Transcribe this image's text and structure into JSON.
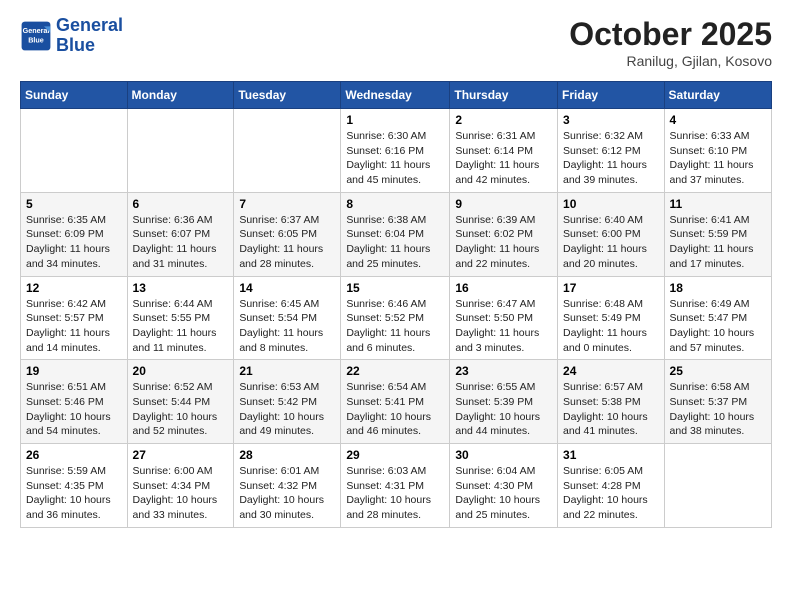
{
  "header": {
    "logo_line1": "General",
    "logo_line2": "Blue",
    "month_title": "October 2025",
    "location": "Ranilug, Gjilan, Kosovo"
  },
  "weekdays": [
    "Sunday",
    "Monday",
    "Tuesday",
    "Wednesday",
    "Thursday",
    "Friday",
    "Saturday"
  ],
  "weeks": [
    [
      {
        "day": "",
        "info": ""
      },
      {
        "day": "",
        "info": ""
      },
      {
        "day": "",
        "info": ""
      },
      {
        "day": "1",
        "info": "Sunrise: 6:30 AM\nSunset: 6:16 PM\nDaylight: 11 hours\nand 45 minutes."
      },
      {
        "day": "2",
        "info": "Sunrise: 6:31 AM\nSunset: 6:14 PM\nDaylight: 11 hours\nand 42 minutes."
      },
      {
        "day": "3",
        "info": "Sunrise: 6:32 AM\nSunset: 6:12 PM\nDaylight: 11 hours\nand 39 minutes."
      },
      {
        "day": "4",
        "info": "Sunrise: 6:33 AM\nSunset: 6:10 PM\nDaylight: 11 hours\nand 37 minutes."
      }
    ],
    [
      {
        "day": "5",
        "info": "Sunrise: 6:35 AM\nSunset: 6:09 PM\nDaylight: 11 hours\nand 34 minutes."
      },
      {
        "day": "6",
        "info": "Sunrise: 6:36 AM\nSunset: 6:07 PM\nDaylight: 11 hours\nand 31 minutes."
      },
      {
        "day": "7",
        "info": "Sunrise: 6:37 AM\nSunset: 6:05 PM\nDaylight: 11 hours\nand 28 minutes."
      },
      {
        "day": "8",
        "info": "Sunrise: 6:38 AM\nSunset: 6:04 PM\nDaylight: 11 hours\nand 25 minutes."
      },
      {
        "day": "9",
        "info": "Sunrise: 6:39 AM\nSunset: 6:02 PM\nDaylight: 11 hours\nand 22 minutes."
      },
      {
        "day": "10",
        "info": "Sunrise: 6:40 AM\nSunset: 6:00 PM\nDaylight: 11 hours\nand 20 minutes."
      },
      {
        "day": "11",
        "info": "Sunrise: 6:41 AM\nSunset: 5:59 PM\nDaylight: 11 hours\nand 17 minutes."
      }
    ],
    [
      {
        "day": "12",
        "info": "Sunrise: 6:42 AM\nSunset: 5:57 PM\nDaylight: 11 hours\nand 14 minutes."
      },
      {
        "day": "13",
        "info": "Sunrise: 6:44 AM\nSunset: 5:55 PM\nDaylight: 11 hours\nand 11 minutes."
      },
      {
        "day": "14",
        "info": "Sunrise: 6:45 AM\nSunset: 5:54 PM\nDaylight: 11 hours\nand 8 minutes."
      },
      {
        "day": "15",
        "info": "Sunrise: 6:46 AM\nSunset: 5:52 PM\nDaylight: 11 hours\nand 6 minutes."
      },
      {
        "day": "16",
        "info": "Sunrise: 6:47 AM\nSunset: 5:50 PM\nDaylight: 11 hours\nand 3 minutes."
      },
      {
        "day": "17",
        "info": "Sunrise: 6:48 AM\nSunset: 5:49 PM\nDaylight: 11 hours\nand 0 minutes."
      },
      {
        "day": "18",
        "info": "Sunrise: 6:49 AM\nSunset: 5:47 PM\nDaylight: 10 hours\nand 57 minutes."
      }
    ],
    [
      {
        "day": "19",
        "info": "Sunrise: 6:51 AM\nSunset: 5:46 PM\nDaylight: 10 hours\nand 54 minutes."
      },
      {
        "day": "20",
        "info": "Sunrise: 6:52 AM\nSunset: 5:44 PM\nDaylight: 10 hours\nand 52 minutes."
      },
      {
        "day": "21",
        "info": "Sunrise: 6:53 AM\nSunset: 5:42 PM\nDaylight: 10 hours\nand 49 minutes."
      },
      {
        "day": "22",
        "info": "Sunrise: 6:54 AM\nSunset: 5:41 PM\nDaylight: 10 hours\nand 46 minutes."
      },
      {
        "day": "23",
        "info": "Sunrise: 6:55 AM\nSunset: 5:39 PM\nDaylight: 10 hours\nand 44 minutes."
      },
      {
        "day": "24",
        "info": "Sunrise: 6:57 AM\nSunset: 5:38 PM\nDaylight: 10 hours\nand 41 minutes."
      },
      {
        "day": "25",
        "info": "Sunrise: 6:58 AM\nSunset: 5:37 PM\nDaylight: 10 hours\nand 38 minutes."
      }
    ],
    [
      {
        "day": "26",
        "info": "Sunrise: 5:59 AM\nSunset: 4:35 PM\nDaylight: 10 hours\nand 36 minutes."
      },
      {
        "day": "27",
        "info": "Sunrise: 6:00 AM\nSunset: 4:34 PM\nDaylight: 10 hours\nand 33 minutes."
      },
      {
        "day": "28",
        "info": "Sunrise: 6:01 AM\nSunset: 4:32 PM\nDaylight: 10 hours\nand 30 minutes."
      },
      {
        "day": "29",
        "info": "Sunrise: 6:03 AM\nSunset: 4:31 PM\nDaylight: 10 hours\nand 28 minutes."
      },
      {
        "day": "30",
        "info": "Sunrise: 6:04 AM\nSunset: 4:30 PM\nDaylight: 10 hours\nand 25 minutes."
      },
      {
        "day": "31",
        "info": "Sunrise: 6:05 AM\nSunset: 4:28 PM\nDaylight: 10 hours\nand 22 minutes."
      },
      {
        "day": "",
        "info": ""
      }
    ]
  ]
}
